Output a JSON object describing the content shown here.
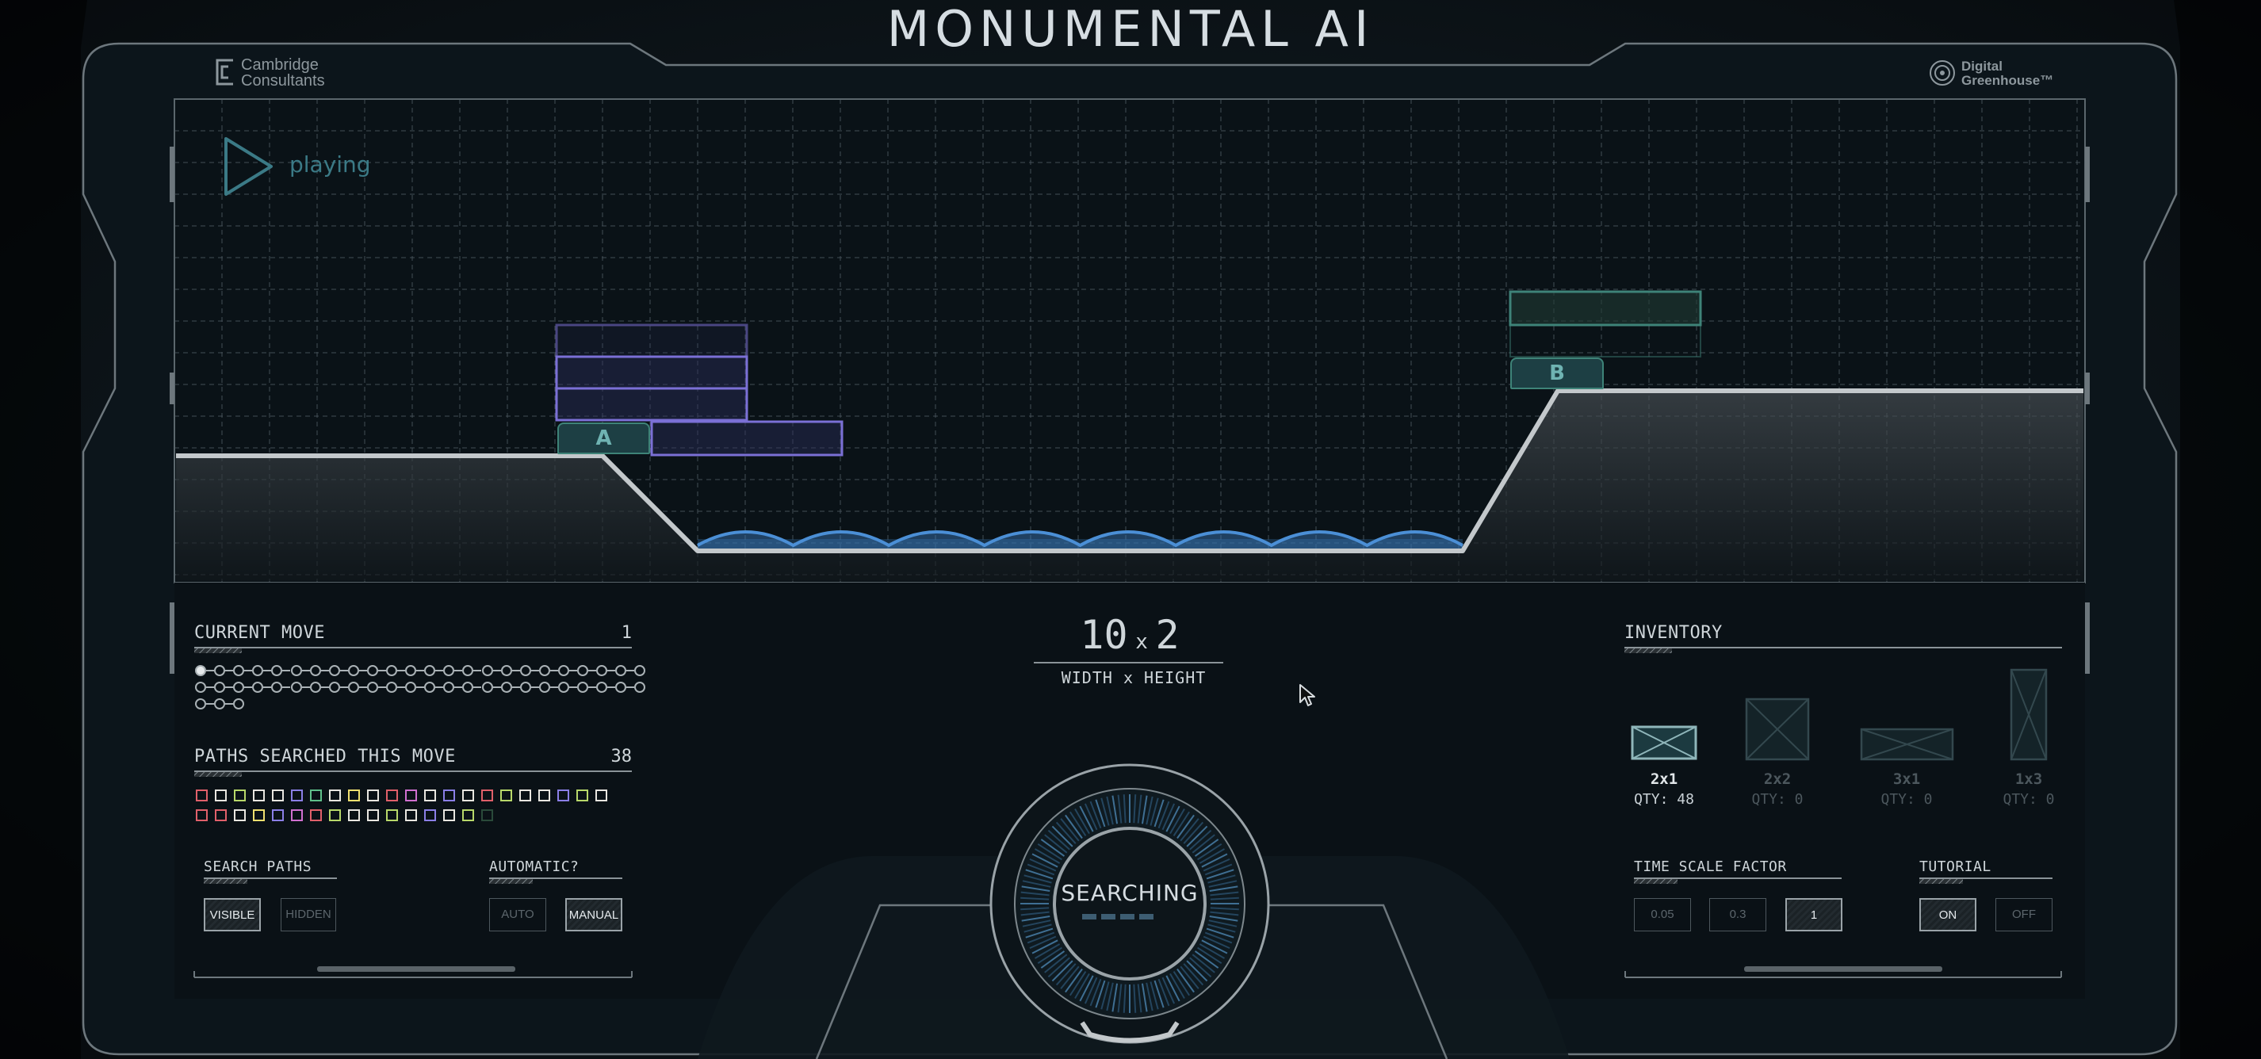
{
  "app_title": "MONUMENTAL AI",
  "logos": {
    "left": [
      "Cambridge",
      "Consultants"
    ],
    "right": [
      "Digital",
      "Greenhouse™"
    ]
  },
  "playback": {
    "status": "playing"
  },
  "markers": {
    "start": "A",
    "goal": "B"
  },
  "dimensions": {
    "width": "10",
    "x": "x",
    "height": "2",
    "label": "WIDTH x HEIGHT"
  },
  "current_move": {
    "label": "CURRENT MOVE",
    "value": "1",
    "total_dots": 51,
    "completed_dots": 1
  },
  "paths_searched": {
    "label": "PATHS SEARCHED THIS MOVE",
    "value": "38",
    "square_colors": [
      "#e0606a",
      "#e8e6e0",
      "#b8d86a",
      "#e8e6e0",
      "#e8e6e0",
      "#8b7fe6",
      "#5fc08a",
      "#e8e6e0",
      "#f0e070",
      "#e8e6e0",
      "#e0606a",
      "#d070d0",
      "#e8e6e0",
      "#8b7fe6",
      "#e8e6e0",
      "#e0606a",
      "#b8d86a",
      "#e8e6e0",
      "#e8e6e0",
      "#8b7fe6",
      "#b8d86a",
      "#e8e6e0",
      "#e0606a",
      "#e0606a",
      "#e8e6e0",
      "#f0e070",
      "#8b7fe6",
      "#d070d0",
      "#e0606a",
      "#b8d86a",
      "#e8e6e0",
      "#e8e6e0",
      "#b8d86a",
      "#e8e6e0",
      "#8b7fe6",
      "#e8e6e0",
      "#b8d86a",
      "#2a4a3a"
    ]
  },
  "search_paths": {
    "label": "SEARCH PATHS",
    "options": [
      "VISIBLE",
      "HIDDEN"
    ],
    "selected": "VISIBLE"
  },
  "automatic": {
    "label": "AUTOMATIC?",
    "options": [
      "AUTO",
      "MANUAL"
    ],
    "selected": "MANUAL"
  },
  "status": {
    "text": "SEARCHING"
  },
  "inventory": {
    "label": "INVENTORY",
    "items": [
      {
        "size": "2x1",
        "qty": "QTY: 48",
        "active": true
      },
      {
        "size": "2x2",
        "qty": "QTY: 0",
        "active": false
      },
      {
        "size": "3x1",
        "qty": "QTY: 0",
        "active": false
      },
      {
        "size": "1x3",
        "qty": "QTY: 0",
        "active": false
      }
    ]
  },
  "time_scale": {
    "label": "TIME SCALE FACTOR",
    "options": [
      "0.05",
      "0.3",
      "1"
    ],
    "selected": "1"
  },
  "tutorial": {
    "label": "TUTORIAL",
    "options": [
      "ON",
      "OFF"
    ],
    "selected": "ON"
  },
  "colors": {
    "accent": "#3b7a86",
    "block_purple": "#7b70d6",
    "wave_blue": "#4b8fd6",
    "ground": "#b9bfc3"
  }
}
